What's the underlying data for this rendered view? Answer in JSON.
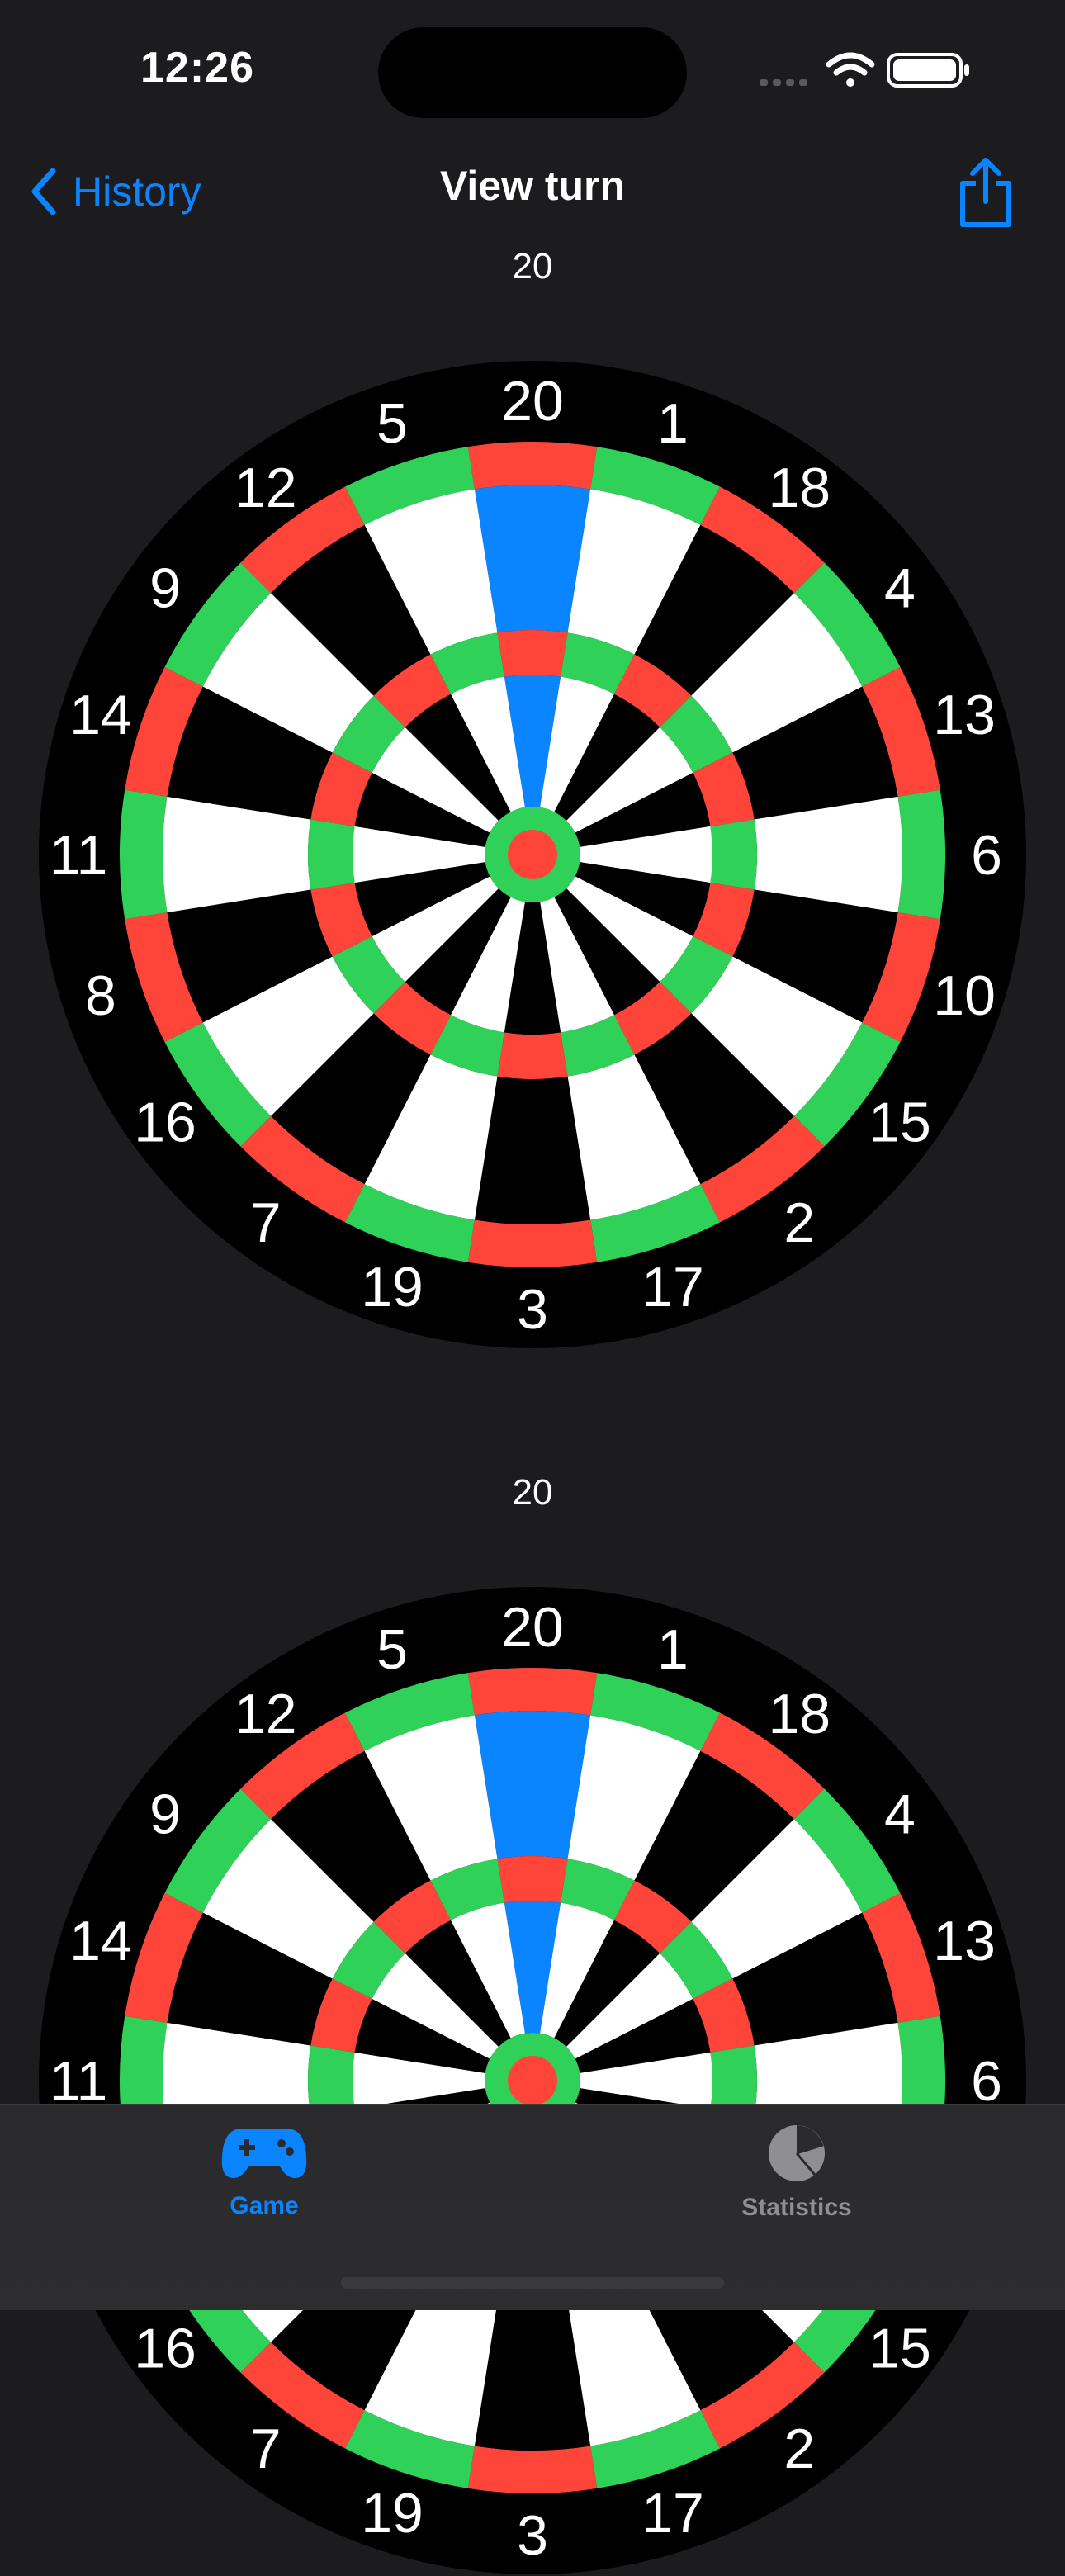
{
  "status": {
    "time": "12:26"
  },
  "nav": {
    "back_label": "History",
    "title": "View turn"
  },
  "boards": [
    {
      "label": "20",
      "highlight": "20"
    },
    {
      "label": "20",
      "highlight": "20"
    }
  ],
  "dartboard": {
    "numbers": [
      "20",
      "1",
      "18",
      "4",
      "13",
      "6",
      "10",
      "15",
      "2",
      "17",
      "3",
      "19",
      "7",
      "16",
      "8",
      "11",
      "14",
      "9",
      "12",
      "5"
    ]
  },
  "colors": {
    "accent": "#0a84ff",
    "red": "#ff453a",
    "green": "#30d158",
    "black": "#000000",
    "white": "#ffffff",
    "highlight": "#0a84ff"
  },
  "tabs": [
    {
      "label": "Game",
      "icon": "gamecontroller-icon",
      "active": true
    },
    {
      "label": "Statistics",
      "icon": "chart-pie-icon",
      "active": false
    }
  ]
}
